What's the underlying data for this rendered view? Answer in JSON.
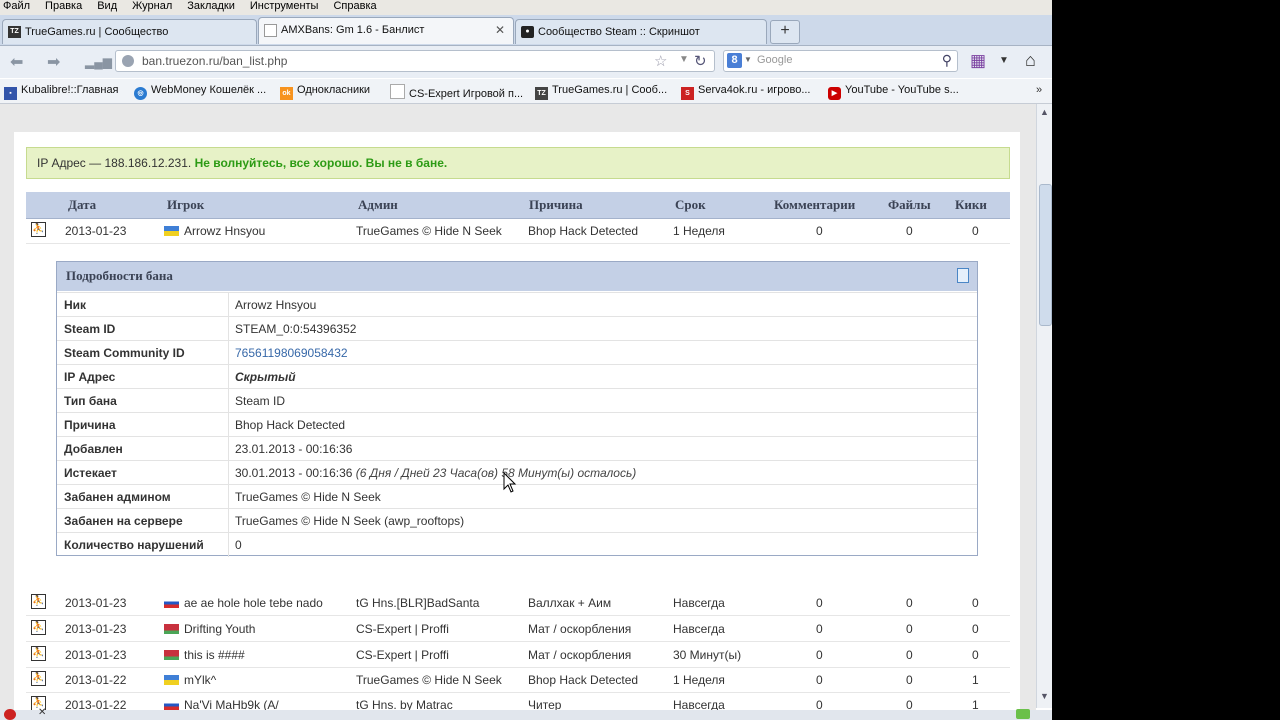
{
  "menu": [
    "Файл",
    "Правка",
    "Вид",
    "Журнал",
    "Закладки",
    "Инструменты",
    "Справка"
  ],
  "tabs": [
    {
      "label": "TrueGames.ru | Сообщество",
      "icon": "TZ"
    },
    {
      "label": "AMXBans: Gm 1.6 - Банлист",
      "icon": ""
    },
    {
      "label": "Сообщество Steam :: Скриншот",
      "icon": "steam"
    }
  ],
  "newtab_label": "+",
  "address": {
    "domain": "ban.truezon.ru",
    "path": "/ban_list.php"
  },
  "search": {
    "placeholder": "Google",
    "engine": "8"
  },
  "bookmarks": [
    {
      "label": "Kubalibre!::Главная",
      "color": "#3355aa"
    },
    {
      "label": "WebMoney Кошелёк ...",
      "color": "#2b7bd1"
    },
    {
      "label": "Однокласники",
      "color": "#f7931e"
    },
    {
      "label": "CS-Expert Игровой п...",
      "color": "#ffffff"
    },
    {
      "label": "TrueGames.ru | Сооб...",
      "color": "#444444"
    },
    {
      "label": "Serva4ok.ru - игрово...",
      "color": "#cc2222"
    },
    {
      "label": "YouTube - YouTube s...",
      "color": "#cc0000"
    }
  ],
  "notice": {
    "prefix": "IP Адрес — 188.186.12.231.",
    "message": "Не волнуйтесь, все хорошо. Вы не в бане."
  },
  "table": {
    "headers": [
      "Дата",
      "Игрок",
      "Админ",
      "Причина",
      "Срок",
      "Комментарии",
      "Файлы",
      "Кики"
    ],
    "rows": [
      {
        "date": "2013-01-23",
        "flag": "ua",
        "player": "Arrowz Hnsyou",
        "admin": "TrueGames © Hide N Seek",
        "reason": "Bhop Hack Detected",
        "term": "1 Неделя",
        "comments": "0",
        "files": "0",
        "kicks": "0"
      },
      {
        "date": "2013-01-23",
        "flag": "ru",
        "player": "ae ae hole hole tebe nado",
        "admin": "tG Hns.[BLR]BadSanta",
        "reason": "Валлхак + Аим",
        "term": "Навсегда",
        "comments": "0",
        "files": "0",
        "kicks": "0"
      },
      {
        "date": "2013-01-23",
        "flag": "by",
        "player": "Drifting Youth",
        "admin": "CS-Expert | Proffi",
        "reason": "Мат / оскорбления",
        "term": "Навсегда",
        "comments": "0",
        "files": "0",
        "kicks": "0"
      },
      {
        "date": "2013-01-23",
        "flag": "by",
        "player": "this is ####",
        "admin": "CS-Expert | Proffi",
        "reason": "Мат / оскорбления",
        "term": "30 Минут(ы)",
        "comments": "0",
        "files": "0",
        "kicks": "0"
      },
      {
        "date": "2013-01-22",
        "flag": "ua",
        "player": "mYlk^",
        "admin": "TrueGames © Hide N Seek",
        "reason": "Bhop Hack Detected",
        "term": "1 Неделя",
        "comments": "0",
        "files": "0",
        "kicks": "1"
      },
      {
        "date": "2013-01-22",
        "flag": "ru",
        "player": "Na'Vi MaHb9k (A/",
        "admin": "tG Hns. by Matrac",
        "reason": "Читер",
        "term": "Навсегда",
        "comments": "0",
        "files": "0",
        "kicks": "1"
      }
    ]
  },
  "details": {
    "title": "Подробности бана",
    "rows": [
      {
        "key": "Ник",
        "value": "Arrowz Hnsyou"
      },
      {
        "key": "Steam ID",
        "value": "STEAM_0:0:54396352"
      },
      {
        "key": "Steam Community ID",
        "value": "76561198069058432"
      },
      {
        "key": "IP Адрес",
        "value": "Скрытый"
      },
      {
        "key": "Тип бана",
        "value": "Steam ID"
      },
      {
        "key": "Причина",
        "value": "Bhop Hack Detected"
      },
      {
        "key": "Добавлен",
        "value": "23.01.2013 - 00:16:36"
      },
      {
        "key": "Истекает",
        "value": "30.01.2013 - 00:16:36",
        "note": "(6 Дня / Дней 23 Часа(ов) 58 Минут(ы) осталось)"
      },
      {
        "key": "Забанен админом",
        "value": "TrueGames © Hide N Seek"
      },
      {
        "key": "Забанен на сервере",
        "value": "TrueGames © Hide N Seek (awp_rooftops)"
      },
      {
        "key": "Количество нарушений",
        "value": "0"
      }
    ]
  },
  "colors": {
    "header_bg": "#c4d0e6",
    "notice_bg": "#e7f2c7",
    "ok_text": "#2d9b15",
    "link": "#3768a8"
  }
}
